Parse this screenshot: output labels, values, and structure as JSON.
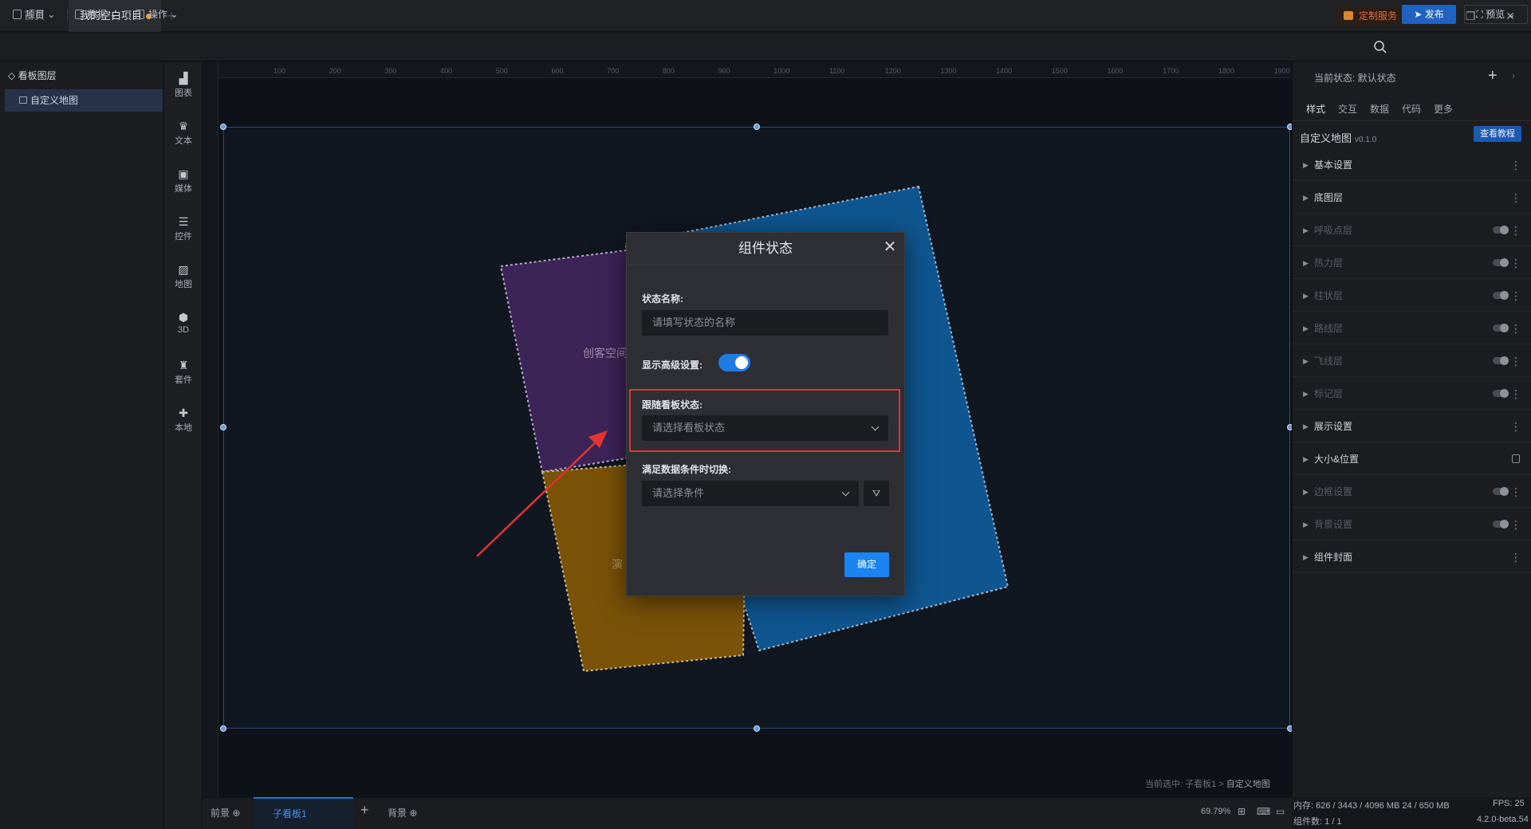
{
  "titlebar": {
    "tabs": [
      {
        "label": "首页"
      },
      {
        "label": "我的空白项目"
      }
    ],
    "service_label": "定制服务"
  },
  "toolbar": {
    "menus": [
      {
        "label": "项目"
      },
      {
        "label": "数据"
      },
      {
        "label": "操作"
      }
    ],
    "publish_label": "发布",
    "preview_label": "预览"
  },
  "left_panel": {
    "header": "看板图层",
    "items": [
      {
        "label": "自定义地图"
      }
    ]
  },
  "icon_bar": [
    {
      "label": "图表",
      "icon": "chart-icon"
    },
    {
      "label": "文本",
      "icon": "text-icon"
    },
    {
      "label": "媒体",
      "icon": "media-icon"
    },
    {
      "label": "控件",
      "icon": "control-icon"
    },
    {
      "label": "地图",
      "icon": "map-icon"
    },
    {
      "label": "3D",
      "icon": "cube-icon"
    },
    {
      "label": "套件",
      "icon": "kit-icon"
    },
    {
      "label": "本地",
      "icon": "local-icon"
    }
  ],
  "ruler": {
    "ticks": [
      "100",
      "200",
      "300",
      "400",
      "500",
      "600",
      "700",
      "800",
      "900",
      "1000",
      "1100",
      "1200",
      "1300",
      "1400",
      "1500",
      "1600",
      "1700",
      "1800",
      "1900"
    ]
  },
  "canvas": {
    "shape_labels": [
      "创客空间",
      "演"
    ],
    "selection_prefix": "当前选中: 子看板1 > ",
    "selection_target": "自定义地图"
  },
  "bottombar": {
    "foreground_label": "前景",
    "subboard_label": "子看板1",
    "background_label": "背景",
    "zoom": "69.79%"
  },
  "right_panel": {
    "state_label": "当前状态: 默认状态",
    "tabs": [
      {
        "label": "样式"
      },
      {
        "label": "交互"
      },
      {
        "label": "数据"
      },
      {
        "label": "代码"
      },
      {
        "label": "更多"
      }
    ],
    "component_name": "自定义地图",
    "component_version": "v0.1.0",
    "tutorial_label": "查看教程",
    "sections": [
      {
        "label": "基本设置",
        "kind": "menu",
        "enabled": true
      },
      {
        "label": "底图层",
        "kind": "menu",
        "enabled": true
      },
      {
        "label": "呼吸点层",
        "kind": "toggle",
        "enabled": false
      },
      {
        "label": "热力层",
        "kind": "toggle",
        "enabled": false
      },
      {
        "label": "柱状层",
        "kind": "toggle",
        "enabled": false
      },
      {
        "label": "路线层",
        "kind": "toggle",
        "enabled": false
      },
      {
        "label": "飞线层",
        "kind": "toggle",
        "enabled": false
      },
      {
        "label": "标记层",
        "kind": "toggle",
        "enabled": false
      },
      {
        "label": "展示设置",
        "kind": "menu",
        "enabled": true
      },
      {
        "label": "大小&位置",
        "kind": "lock",
        "enabled": true
      },
      {
        "label": "边框设置",
        "kind": "toggle",
        "enabled": false
      },
      {
        "label": "背景设置",
        "kind": "toggle",
        "enabled": false
      },
      {
        "label": "组件封面",
        "kind": "menu",
        "enabled": true
      }
    ]
  },
  "statusbar": {
    "memory": "内存: 626 / 3443 / 4096 MB  24 / 650 MB",
    "component_count": "组件数: 1 / 1",
    "fps": "FPS: 25",
    "version": "4.2.0-beta.54"
  },
  "modal": {
    "title": "组件状态",
    "name_label": "状态名称:",
    "name_placeholder": "请填写状态的名称",
    "advanced_label": "显示高级设置:",
    "advanced_on": true,
    "follow_label": "跟随看板状态:",
    "follow_placeholder": "请选择看板状态",
    "condition_label": "满足数据条件时切换:",
    "condition_placeholder": "请选择条件",
    "confirm_label": "确定"
  },
  "colors": {
    "accent": "#1b84f0",
    "highlight_box": "#e03535",
    "arrow": "#e03535",
    "purple_shape": "#3d2457",
    "blue_shape": "#0f5690",
    "orange_shape": "#7a5208"
  }
}
